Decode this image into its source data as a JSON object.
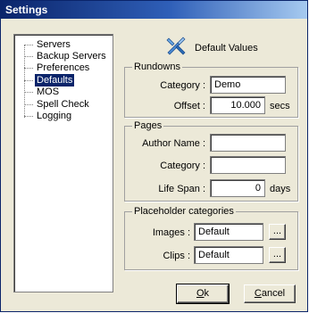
{
  "window": {
    "title": "Settings"
  },
  "tree": {
    "items": [
      {
        "label": "Servers",
        "selected": false
      },
      {
        "label": "Backup Servers",
        "selected": false
      },
      {
        "label": "Preferences",
        "selected": false
      },
      {
        "label": "Defaults",
        "selected": true
      },
      {
        "label": "MOS",
        "selected": false
      },
      {
        "label": "Spell Check",
        "selected": false
      },
      {
        "label": "Logging",
        "selected": false
      }
    ]
  },
  "header": {
    "icon": "defaults-icon",
    "title": "Default Values"
  },
  "rundowns": {
    "caption": "Rundowns",
    "category_label": "Category :",
    "category_value": "Demo",
    "offset_label": "Offset :",
    "offset_value": "10.000",
    "offset_unit": "secs"
  },
  "pages": {
    "caption": "Pages",
    "author_label": "Author Name :",
    "author_value": "",
    "category_label": "Category :",
    "category_value": "",
    "lifespan_label": "Life Span :",
    "lifespan_value": "0",
    "lifespan_unit": "days"
  },
  "placeholder": {
    "caption": "Placeholder categories",
    "images_label": "Images :",
    "images_value": "Default",
    "clips_label": "Clips :",
    "clips_value": "Default",
    "browse_label": "..."
  },
  "buttons": {
    "ok_mnemonic": "O",
    "ok_rest": "k",
    "cancel_mnemonic": "C",
    "cancel_rest": "ancel"
  },
  "colors": {
    "titlebar": "#0a246a",
    "selection": "#0a246a",
    "face": "#ece9d8"
  }
}
